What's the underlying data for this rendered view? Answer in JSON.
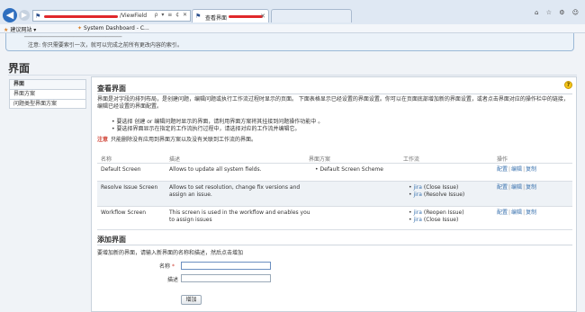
{
  "browser": {
    "address_suffix": "/ViewField",
    "address_controls": "ρ ▾ ≡ ¢ ✕",
    "tabs": [
      {
        "label": "查看界面",
        "close": "✕"
      }
    ],
    "window_controls": "⌂ ☆ ⚙ ☺",
    "favorites": [
      {
        "label": "建议网站 ▾"
      },
      {
        "label": "System Dashboard - C..."
      }
    ]
  },
  "notice": {
    "line1": "──────────────────────────────",
    "line2": "注意: 你只需要索引一次，就可以完成之前所有更改内容的索引。"
  },
  "page_title": "界面",
  "sidebar": {
    "items": [
      {
        "label": "界面"
      },
      {
        "label": "界面方案"
      },
      {
        "label": "问题类型界面方案"
      }
    ]
  },
  "main": {
    "help_icon": "?",
    "section_title": "查看界面",
    "intro": "界面是对字段的排列布局，是创建问题，编辑问题或执行工作流过程时显示的页面。 下面表格显示已经设置的界面设置。你可以在页面底部增加新的界面设置，或者点击界面对应的操作栏中的链接，编辑已经设置的界面配置。",
    "bullet1": "• 要选择 创建 or 编辑问题时显示的界面，请利用界面方案将其挂接到问题操作功能中 。",
    "bullet2": "• 要选择界面显示在指定的工作流执行过程中，请选择对应的工作流并编辑它。",
    "note_label": "注意",
    "note_text": "只能删除没有应用到界面方案以及没有关联到工作流的界面。",
    "table": {
      "headers": [
        "名称",
        "描述",
        "界面方案",
        "工作流",
        "操作"
      ],
      "rows": [
        {
          "name": "Default Screen",
          "desc": "Allows to update all system fields.",
          "scheme": "• Default Screen Scheme",
          "workflow": [],
          "ops": [
            "配置",
            "编辑",
            "复制"
          ]
        },
        {
          "name": "Resolve Issue Screen",
          "desc": "Allows to set resolution, change fix versions and assign an issue.",
          "scheme": "",
          "workflow": [
            {
              "wf": "jira",
              "action": "(Close Issue)"
            },
            {
              "wf": "jira",
              "action": "(Resolve Issue)"
            }
          ],
          "ops": [
            "配置",
            "编辑",
            "复制"
          ]
        },
        {
          "name": "Workflow Screen",
          "desc": "This screen is used in the workflow and enables you to assign issues",
          "scheme": "",
          "workflow": [
            {
              "wf": "jira",
              "action": "(Reopen Issue)"
            },
            {
              "wf": "jira",
              "action": "(Close Issue)"
            }
          ],
          "ops": [
            "配置",
            "编辑",
            "复制"
          ]
        }
      ]
    },
    "add_section_title": "添加界面",
    "add_hint": "要增加新的界面，请输入新界面的名称和描述，然后点击增加",
    "name_label": "名称",
    "required_mark": "*",
    "desc_label": "描述",
    "name_value": "",
    "desc_value": "",
    "add_button": "增加"
  }
}
